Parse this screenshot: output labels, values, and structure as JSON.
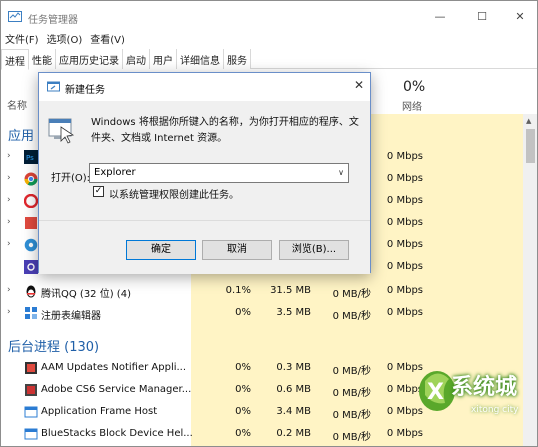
{
  "window": {
    "title": "任务管理器"
  },
  "menu": [
    "文件(F)",
    "选项(O)",
    "查看(V)"
  ],
  "tabs": [
    "进程",
    "性能",
    "应用历史记录",
    "启动",
    "用户",
    "详细信息",
    "服务"
  ],
  "columns": {
    "name": "名称",
    "network_pct": "0%",
    "network": "网络"
  },
  "groups": {
    "apps": "应用",
    "background": "后台进程 (130)"
  },
  "app_rows": [
    {
      "net": "0 Mbps"
    },
    {
      "net": "0 Mbps"
    },
    {
      "net": "0 Mbps"
    },
    {
      "net": "0 Mbps"
    },
    {
      "net": "0 Mbps"
    },
    {
      "net": "0 Mbps"
    }
  ],
  "full_rows": [
    {
      "name": "腾讯QQ (32 位) (4)",
      "cpu": "0.1%",
      "mem": "31.5 MB",
      "disk": "0 MB/秒",
      "net": "0 Mbps"
    },
    {
      "name": "注册表编辑器",
      "cpu": "0%",
      "mem": "3.5 MB",
      "disk": "0 MB/秒",
      "net": "0 Mbps"
    }
  ],
  "bg_rows": [
    {
      "name": "AAM Updates Notifier Appli...",
      "cpu": "0%",
      "mem": "0.3 MB",
      "disk": "0 MB/秒",
      "net": "0 Mbps"
    },
    {
      "name": "Adobe CS6 Service Manager...",
      "cpu": "0%",
      "mem": "0.6 MB",
      "disk": "0 MB/秒",
      "net": "0 Mbps"
    },
    {
      "name": "Application Frame Host",
      "cpu": "0%",
      "mem": "3.4 MB",
      "disk": "0 MB/秒",
      "net": "0 Mbps"
    },
    {
      "name": "BlueStacks Block Device Hel...",
      "cpu": "0%",
      "mem": "0.2 MB",
      "disk": "0 MB/秒",
      "net": "0 Mbps"
    }
  ],
  "dialog": {
    "title": "新建任务",
    "description": "Windows 将根据你所键入的名称，为你打开相应的程序、文件夹、文档或 Internet 资源。",
    "open_label": "打开(O):",
    "open_value": "Explorer",
    "checkbox_label": "以系统管理权限创建此任务。",
    "checkbox_checked": true,
    "ok": "确定",
    "cancel": "取消",
    "browse": "浏览(B)..."
  },
  "watermark": {
    "text": "系统城",
    "sub": "xitong city"
  },
  "colors": {
    "highlight": "#fff4c5",
    "group": "#1f5fa8",
    "dialog_border": "#6a8fc9"
  }
}
